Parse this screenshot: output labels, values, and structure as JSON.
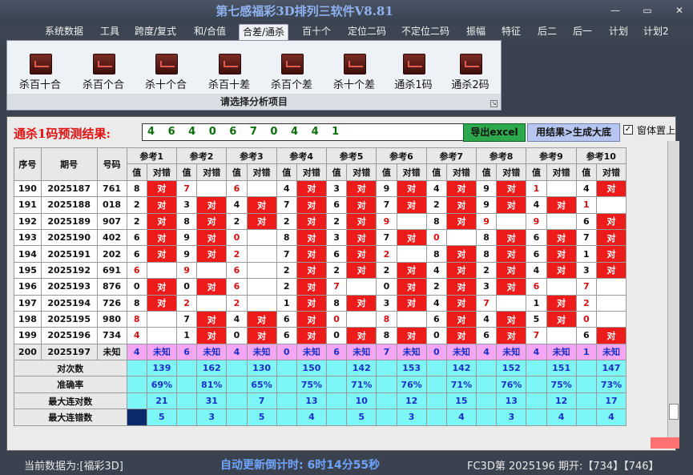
{
  "window": {
    "title": "第七感福彩3D排列三软件V8.81",
    "minimize": "—",
    "maximize": "▭",
    "close": "✕"
  },
  "menu": [
    "系统数据",
    "工具",
    "跨度/复式",
    "和/合值",
    "合差/通杀",
    "百十个",
    "定位二码",
    "不定位二码",
    "振幅",
    "特征",
    "后二",
    "后一",
    "计划",
    "计划2"
  ],
  "ribbon": {
    "buttons": [
      "杀百十合",
      "杀百个合",
      "杀十个合",
      "杀百十差",
      "杀百个差",
      "杀十个差",
      "通杀1码",
      "通杀2码"
    ],
    "caption": "请选择分析项目"
  },
  "prediction": {
    "label": "通杀1码预测结果:",
    "value": "4 6 4 0 6 7 0 4 4 1",
    "excel_button": "导出excel",
    "export_button": "用结果>生成大底",
    "checkbox_label": "窗体置上",
    "checkbox_checked": "✓"
  },
  "table": {
    "head": {
      "seq": "序号",
      "issue": "期号",
      "code": "号码",
      "value_col": "值",
      "result_col": "对错"
    },
    "refs": [
      "参考1",
      "参考2",
      "参考3",
      "参考4",
      "参考5",
      "参考6",
      "参考7",
      "参考8",
      "参考9",
      "参考10"
    ],
    "rows": [
      {
        "seq": "190",
        "issue": "2025187",
        "code": "761",
        "vals": [
          "8",
          "7",
          "6",
          "4",
          "3",
          "9",
          "4",
          "9",
          "1",
          "4"
        ],
        "ok": [
          1,
          0,
          0,
          1,
          1,
          1,
          1,
          1,
          0,
          1
        ],
        "red": [
          0,
          1,
          1,
          0,
          0,
          0,
          0,
          0,
          1,
          0
        ]
      },
      {
        "seq": "191",
        "issue": "2025188",
        "code": "018",
        "vals": [
          "2",
          "3",
          "4",
          "7",
          "6",
          "7",
          "2",
          "9",
          "4",
          "1"
        ],
        "ok": [
          1,
          1,
          1,
          1,
          1,
          1,
          1,
          1,
          1,
          0
        ],
        "red": [
          0,
          0,
          0,
          0,
          0,
          0,
          0,
          0,
          0,
          1
        ]
      },
      {
        "seq": "192",
        "issue": "2025189",
        "code": "907",
        "vals": [
          "2",
          "8",
          "2",
          "2",
          "2",
          "9",
          "8",
          "9",
          "9",
          "6"
        ],
        "ok": [
          1,
          1,
          1,
          1,
          1,
          0,
          1,
          0,
          0,
          1
        ],
        "red": [
          0,
          0,
          0,
          0,
          0,
          1,
          0,
          1,
          1,
          0
        ]
      },
      {
        "seq": "193",
        "issue": "2025190",
        "code": "402",
        "vals": [
          "6",
          "9",
          "0",
          "8",
          "3",
          "7",
          "0",
          "8",
          "6",
          "7"
        ],
        "ok": [
          1,
          1,
          0,
          1,
          1,
          1,
          0,
          1,
          1,
          1
        ],
        "red": [
          0,
          0,
          1,
          0,
          0,
          0,
          1,
          0,
          0,
          0
        ]
      },
      {
        "seq": "194",
        "issue": "2025191",
        "code": "202",
        "vals": [
          "6",
          "9",
          "2",
          "7",
          "6",
          "2",
          "8",
          "8",
          "6",
          "1"
        ],
        "ok": [
          1,
          1,
          0,
          1,
          1,
          0,
          1,
          1,
          1,
          1
        ],
        "red": [
          0,
          0,
          1,
          0,
          0,
          1,
          0,
          0,
          0,
          0
        ]
      },
      {
        "seq": "195",
        "issue": "2025192",
        "code": "691",
        "vals": [
          "6",
          "9",
          "6",
          "2",
          "2",
          "2",
          "4",
          "2",
          "4",
          "3"
        ],
        "ok": [
          0,
          0,
          0,
          1,
          1,
          1,
          1,
          1,
          1,
          1
        ],
        "red": [
          1,
          1,
          1,
          0,
          0,
          0,
          0,
          0,
          0,
          0
        ]
      },
      {
        "seq": "196",
        "issue": "2025193",
        "code": "876",
        "vals": [
          "0",
          "0",
          "6",
          "2",
          "7",
          "0",
          "2",
          "3",
          "6",
          "7"
        ],
        "ok": [
          1,
          1,
          0,
          1,
          0,
          1,
          1,
          1,
          0,
          0
        ],
        "red": [
          0,
          0,
          1,
          0,
          1,
          0,
          0,
          0,
          1,
          1
        ]
      },
      {
        "seq": "197",
        "issue": "2025194",
        "code": "726",
        "vals": [
          "8",
          "2",
          "2",
          "1",
          "8",
          "3",
          "4",
          "7",
          "1",
          "2"
        ],
        "ok": [
          1,
          0,
          0,
          1,
          1,
          1,
          1,
          0,
          1,
          0
        ],
        "red": [
          0,
          1,
          1,
          0,
          0,
          0,
          0,
          1,
          0,
          1
        ]
      },
      {
        "seq": "198",
        "issue": "2025195",
        "code": "980",
        "vals": [
          "8",
          "7",
          "4",
          "6",
          "0",
          "8",
          "6",
          "4",
          "5",
          "0"
        ],
        "ok": [
          0,
          1,
          1,
          1,
          0,
          0,
          1,
          1,
          1,
          0
        ],
        "red": [
          1,
          0,
          0,
          0,
          1,
          1,
          0,
          0,
          0,
          1
        ]
      },
      {
        "seq": "199",
        "issue": "2025196",
        "code": "734",
        "vals": [
          "4",
          "1",
          "0",
          "6",
          "0",
          "8",
          "0",
          "6",
          "7",
          "6"
        ],
        "ok": [
          0,
          1,
          1,
          1,
          1,
          1,
          1,
          1,
          0,
          1
        ],
        "red": [
          1,
          0,
          0,
          0,
          0,
          0,
          0,
          0,
          1,
          0
        ]
      }
    ],
    "pending": {
      "seq": "200",
      "issue": "2025197",
      "code": "未知",
      "vals": [
        "4",
        "6",
        "4",
        "0",
        "6",
        "7",
        "0",
        "4",
        "4",
        "1"
      ],
      "result": "未知"
    },
    "summary": [
      {
        "label": "对次数",
        "values": [
          "139",
          "162",
          "130",
          "150",
          "142",
          "153",
          "142",
          "152",
          "151",
          "147"
        ]
      },
      {
        "label": "准确率",
        "values": [
          "69%",
          "81%",
          "65%",
          "75%",
          "71%",
          "76%",
          "71%",
          "76%",
          "75%",
          "73%"
        ]
      },
      {
        "label": "最大连对数",
        "values": [
          "21",
          "31",
          "7",
          "13",
          "10",
          "12",
          "15",
          "13",
          "12",
          "17"
        ]
      },
      {
        "label": "最大连错数",
        "values": [
          "5",
          "3",
          "5",
          "4",
          "5",
          "3",
          "4",
          "3",
          "4",
          "4"
        ]
      }
    ]
  },
  "status": {
    "data_source": "当前数据为:[福彩3D]",
    "auto_update": "自动更新倒计时: 6时14分55秒",
    "issue_info": "FC3D第 2025196 期开:【734】【746】"
  },
  "colors": {
    "correct": "#ee1b1b",
    "pending_row": "#f4a6f4",
    "summary_row": "#7cf6f6",
    "stat_text": "#1b2fc8"
  }
}
